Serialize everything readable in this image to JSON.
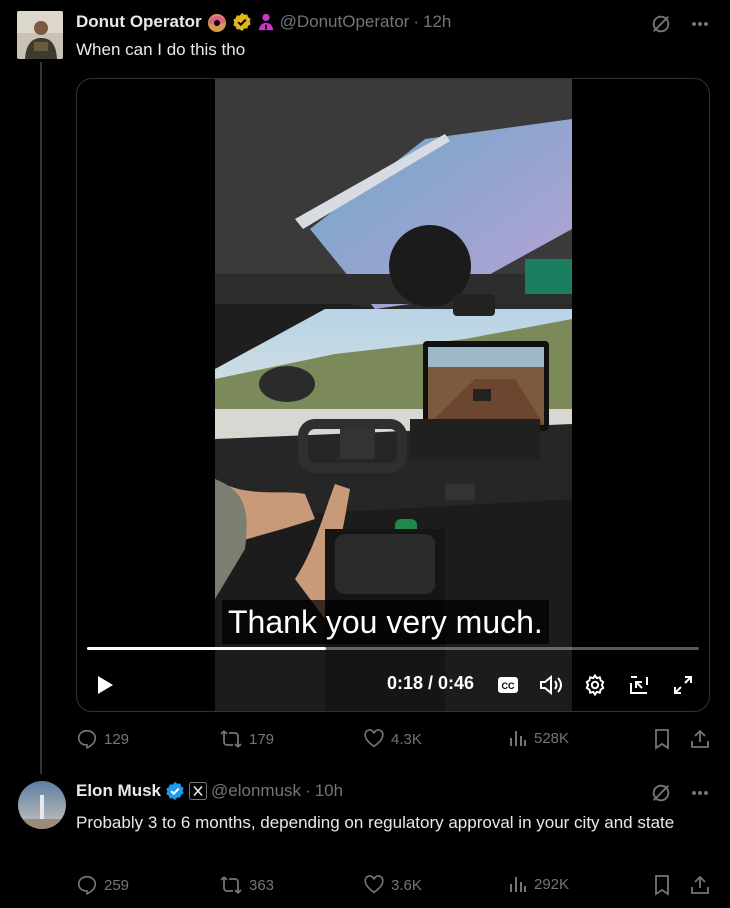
{
  "tweet1": {
    "name": "Donut Operator",
    "handle": "@DonutOperator",
    "dot": "·",
    "time": "12h",
    "text": "When can I do this tho",
    "video": {
      "subtitle": "Thank you very much.",
      "time_display": "0:18 / 0:46",
      "progress": 0.391,
      "cc_label": "CC"
    },
    "actions": {
      "replies": "129",
      "reposts": "179",
      "likes": "4.3K",
      "views": "528K"
    },
    "badge_icons": [
      "donut-emoji-icon",
      "gold-verified-badge-icon",
      "affiliate-person-icon"
    ]
  },
  "tweet2": {
    "name": "Elon Musk",
    "handle": "@elonmusk",
    "dot": "·",
    "time": "10h",
    "text": "Probably 3 to 6 months, depending on regulatory approval in your city and state",
    "actions": {
      "replies": "259",
      "reposts": "363",
      "likes": "3.6K",
      "views": "292K"
    },
    "badge_icons": [
      "blue-verified-badge-icon",
      "x-affiliate-icon"
    ]
  },
  "colors": {
    "background": "#000000",
    "text": "#e7e9ea",
    "muted": "#71767b",
    "verified_blue": "#1d9bf0",
    "verified_gold": "#e2b719",
    "affiliate_pink": "#c936cc"
  }
}
